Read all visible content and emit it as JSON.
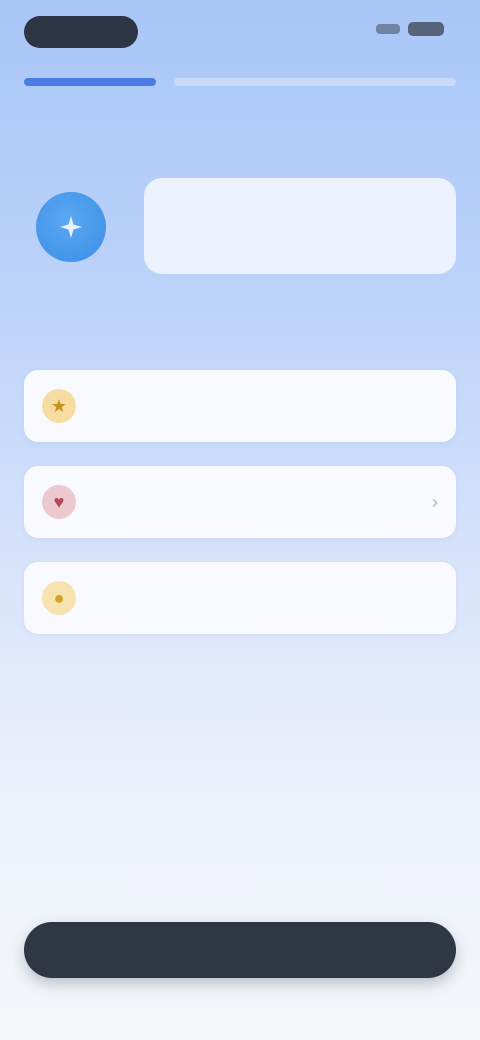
{
  "status": {
    "time": "",
    "icons": [
      "signal-icon",
      "battery-icon"
    ]
  },
  "tabs": [
    {
      "label": "",
      "active": true
    },
    {
      "label": "",
      "active": false
    }
  ],
  "hero": {
    "avatar_icon": "assistant-avatar-icon",
    "bubble_text": ""
  },
  "section_title": "",
  "options": [
    {
      "icon": "star-icon",
      "label": ""
    },
    {
      "icon": "heart-icon",
      "label": ""
    },
    {
      "icon": "bulb-icon",
      "label": ""
    }
  ],
  "cta_label": "",
  "colors": {
    "accent": "#3a6de0",
    "button": "#2f3744",
    "avatar": "#3b8ee6",
    "background_top": "#a9c6f7",
    "background_bottom": "#f5f6fa"
  }
}
